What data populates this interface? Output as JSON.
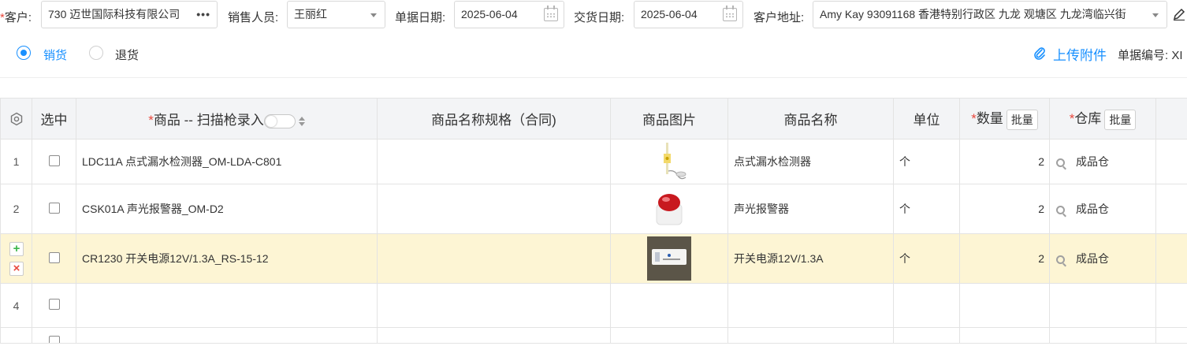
{
  "header": {
    "customer_label": "客户:",
    "customer_value": "730 迈世国际科技有限公司",
    "sales_label": "销售人员:",
    "sales_value": "王丽红",
    "bill_date_label": "单据日期:",
    "bill_date_value": "2025-06-04",
    "delivery_date_label": "交货日期:",
    "delivery_date_value": "2025-06-04",
    "address_label": "客户地址:",
    "address_value": "Amy Kay 93091168 香港特别行政区 九龙 观塘区 九龙湾临兴街",
    "required_mark": "*",
    "more_icon": "ellipsis-icon",
    "edit_icon": "pencil-icon"
  },
  "type_options": {
    "sale_label": "销货",
    "return_label": "退货",
    "selected": "销货"
  },
  "actions": {
    "upload_label": "上传附件",
    "bill_no_label": "单据编号: XI"
  },
  "table": {
    "columns": {
      "settings_icon": "gear-icon",
      "select": "选中",
      "product": "商品 -- 扫描枪录入",
      "spec": "商品名称规格（合同)",
      "image": "商品图片",
      "name": "商品名称",
      "unit": "单位",
      "qty": "数量",
      "warehouse": "仓库",
      "batch_label": "批量"
    },
    "rows": [
      {
        "index": "1",
        "product": "LDC11A 点式漏水检测器_OM-LDA-C801",
        "spec": "",
        "image": "leak-detector-image",
        "name": "点式漏水检测器",
        "unit": "个",
        "qty": "2",
        "warehouse": "成品仓"
      },
      {
        "index": "2",
        "product": "CSK01A 声光报警器_OM-D2",
        "spec": "",
        "image": "alarm-siren-image",
        "name": "声光报警器",
        "unit": "个",
        "qty": "2",
        "warehouse": "成品仓"
      },
      {
        "index": "",
        "product": "CR1230 开关电源12V/1.3A_RS-15-12",
        "spec": "",
        "image": "power-supply-image",
        "name": "开关电源12V/1.3A",
        "unit": "个",
        "qty": "2",
        "warehouse": "成品仓"
      },
      {
        "index": "4",
        "product": "",
        "spec": "",
        "image": "",
        "name": "",
        "unit": "",
        "qty": "",
        "warehouse": ""
      }
    ],
    "add_row_symbol": "+",
    "delete_row_symbol": "×"
  },
  "colors": {
    "accent": "#1890ff",
    "required": "#e8483d",
    "highlight_row": "#fdf5d4",
    "header_bg": "#f3f4f6",
    "add_green": "#3bb54a",
    "delete_red": "#e8483d"
  }
}
